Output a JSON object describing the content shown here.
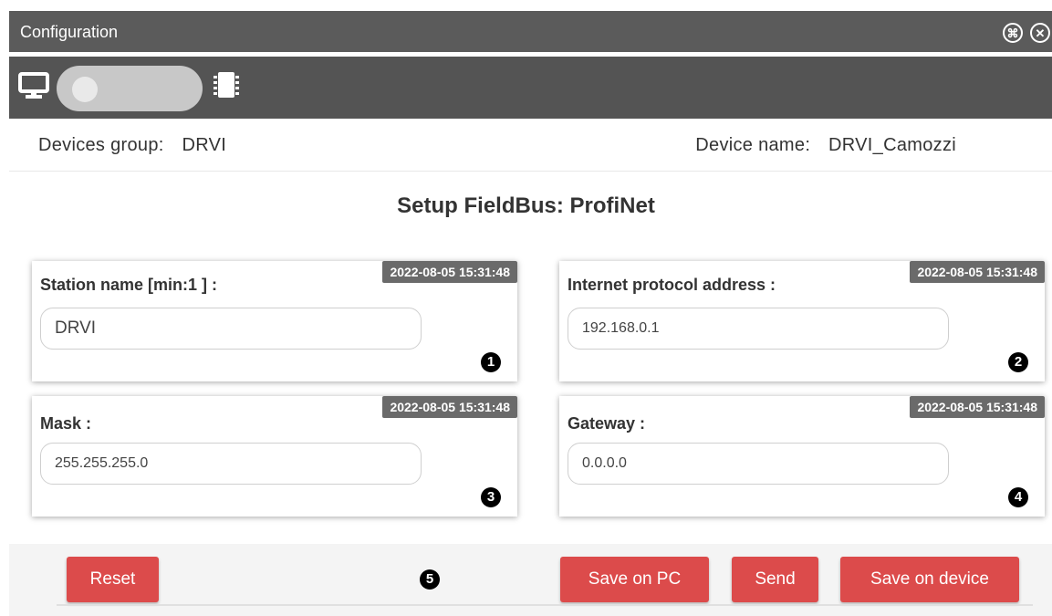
{
  "window": {
    "title": "Configuration",
    "icons": [
      "expand-icon",
      "close-icon"
    ]
  },
  "toolbar": {
    "icons": [
      "monitor-icon",
      "chip-icon"
    ],
    "toggle_state": "pc"
  },
  "info": {
    "devices_group_label": "Devices group:",
    "devices_group_value": "DRVI",
    "device_name_label": "Device name:",
    "device_name_value": "DRVI_Camozzi"
  },
  "section": {
    "title": "Setup FieldBus: ProfiNet"
  },
  "fields": [
    {
      "label": "Station name [min:1 ] :",
      "timestamp": "2022-08-05 15:31:48",
      "value": "DRVI",
      "badge": "1"
    },
    {
      "label": "Internet protocol address :",
      "timestamp": "2022-08-05 15:31:48",
      "value": "192.168.0.1",
      "badge": "2"
    },
    {
      "label": "Mask :",
      "timestamp": "2022-08-05 15:31:48",
      "value": "255.255.255.0",
      "badge": "3"
    },
    {
      "label": "Gateway :",
      "timestamp": "2022-08-05 15:31:48",
      "value": "0.0.0.0",
      "badge": "4"
    }
  ],
  "footer": {
    "reset_label": "Reset",
    "save_pc_label": "Save on PC",
    "send_label": "Send",
    "save_device_label": "Save on device",
    "badge": "5"
  },
  "colors": {
    "titlebar": "#5b5b5b",
    "toolbar": "#545454",
    "button": "#dc4b4b",
    "timestamp_bg": "#6a6a6a"
  }
}
